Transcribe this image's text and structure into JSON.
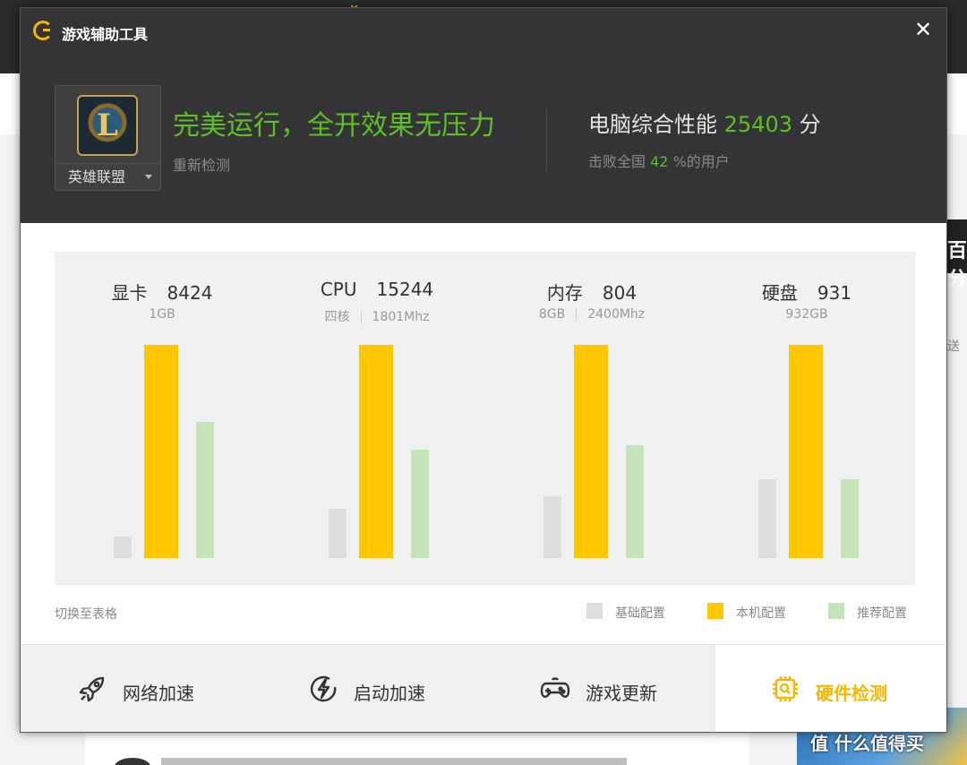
{
  "window": {
    "title": "游戏辅助工具",
    "close_glyph": "✕"
  },
  "game": {
    "name": "英雄联盟",
    "icon_letter": "L"
  },
  "status": {
    "message": "完美运行，全开效果无压力",
    "recheck_label": "重新检测"
  },
  "performance": {
    "label": "电脑综合性能",
    "score": "25403",
    "unit": "分",
    "beat_prefix": "击败全国",
    "beat_percent": "42",
    "beat_suffix": "%的用户"
  },
  "components": [
    {
      "name": "显卡",
      "score": "8424",
      "specs": [
        "1GB"
      ]
    },
    {
      "name": "CPU",
      "score": "15244",
      "specs": [
        "四核",
        "1801Mhz"
      ]
    },
    {
      "name": "内存",
      "score": "804",
      "specs": [
        "8GB",
        "2400Mhz"
      ]
    },
    {
      "name": "硬盘",
      "score": "931",
      "specs": [
        "932GB"
      ]
    }
  ],
  "chart_data": {
    "type": "bar",
    "categories": [
      "显卡",
      "CPU",
      "内存",
      "硬盘"
    ],
    "series": [
      {
        "name": "基础配置",
        "values": [
          0.1,
          0.23,
          0.29,
          0.37
        ]
      },
      {
        "name": "本机配置",
        "values": [
          1.0,
          1.0,
          1.0,
          1.0
        ]
      },
      {
        "name": "推荐配置",
        "values": [
          0.64,
          0.51,
          0.53,
          0.37
        ]
      }
    ],
    "ylim": [
      0,
      1
    ],
    "grid": false,
    "legend": "bottom-right"
  },
  "legend_colors": {
    "基础配置": "#dddddd",
    "本机配置": "#ffc700",
    "推荐配置": "#c5e3b8"
  },
  "toggle_table_label": "切换至表格",
  "bottom_nav": [
    {
      "label": "网络加速",
      "icon": "rocket-icon",
      "active": false
    },
    {
      "label": "启动加速",
      "icon": "lightning-icon",
      "active": false
    },
    {
      "label": "游戏更新",
      "icon": "gamepad-icon",
      "active": false
    },
    {
      "label": "硬件检测",
      "icon": "chip-icon",
      "active": true
    }
  ],
  "background": {
    "right_text": "百分",
    "side_text": "送",
    "watermark": "值 什么值得买"
  },
  "colors": {
    "accent": "#f5b800",
    "green": "#5fbf28",
    "header_bg": "#343335"
  }
}
